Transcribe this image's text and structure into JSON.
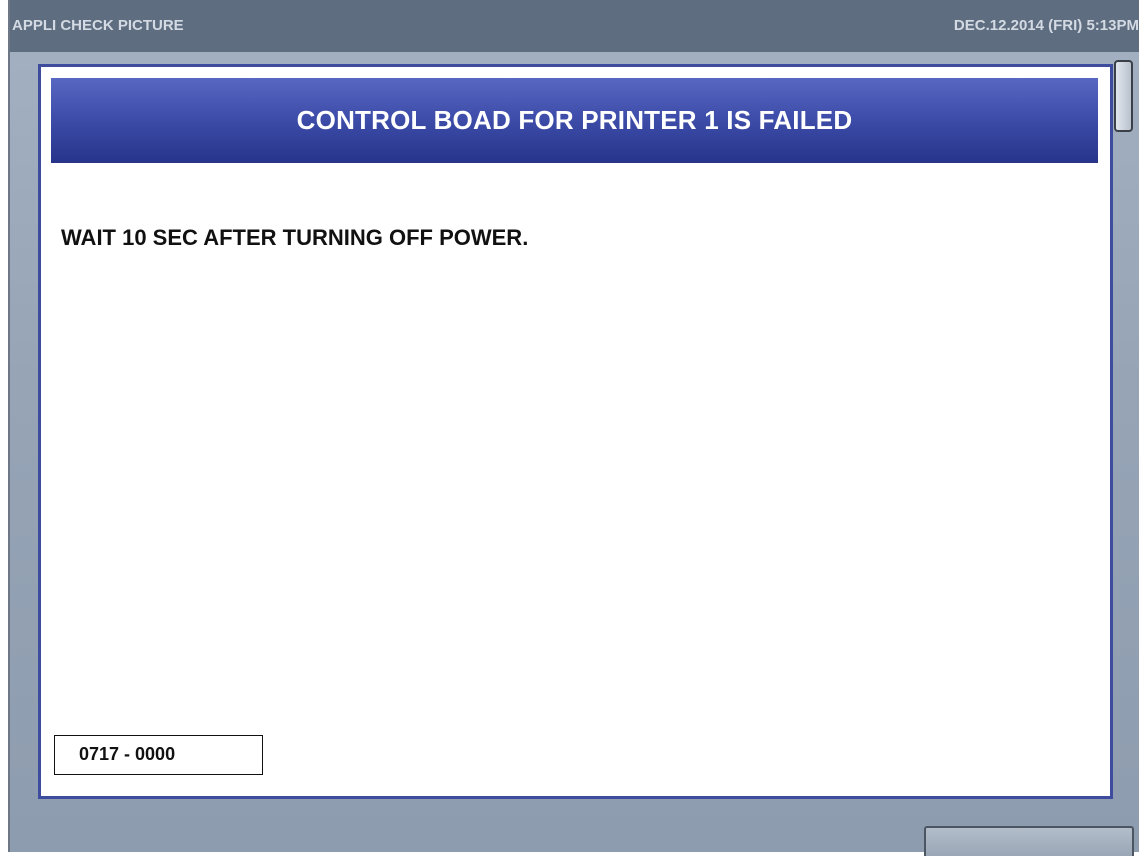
{
  "titlebar": {
    "title": "APPLI CHECK PICTURE",
    "datetime": "DEC.12.2014 (FRI)   5:13PM"
  },
  "dialog": {
    "heading": "CONTROL BOAD FOR PRINTER 1 IS FAILED",
    "message": "WAIT 10 SEC AFTER TURNING OFF POWER.",
    "error_code": "0717 - 0000"
  },
  "colors": {
    "titlebar_bg": "#5e6e80",
    "screen_bg": "#96a4b6",
    "dialog_border": "#3d4c9c",
    "header_bg": "#3e4eaa",
    "header_text": "#ffffff"
  },
  "icons": {
    "scroll_handle": "scroll-handle",
    "corner_button": "button-edge"
  }
}
